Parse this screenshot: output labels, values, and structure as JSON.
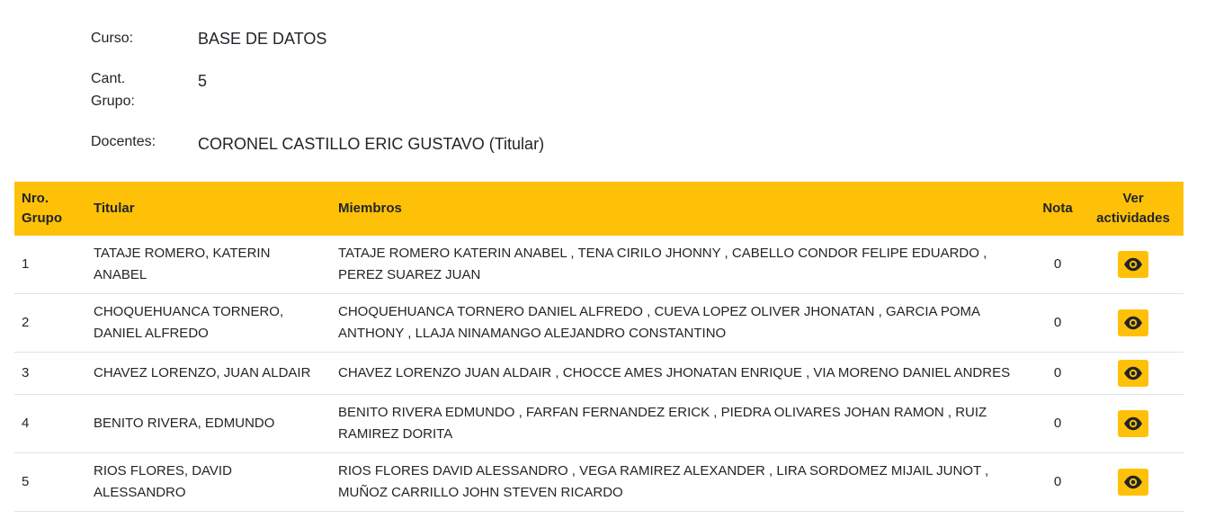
{
  "info": {
    "curso_label": "Curso:",
    "curso_value": "BASE DE DATOS",
    "cant_label": "Cant. Grupo:",
    "cant_value": "5",
    "docentes_label": "Docentes:",
    "docentes_value": "CORONEL CASTILLO ERIC GUSTAVO (Titular)"
  },
  "table": {
    "headers": {
      "nro": "Nro. Grupo",
      "titular": "Titular",
      "miembros": "Miembros",
      "nota": "Nota",
      "ver": "Ver actividades"
    },
    "rows": [
      {
        "nro": "1",
        "titular": "TATAJE ROMERO, KATERIN ANABEL",
        "miembros": "TATAJE ROMERO KATERIN ANABEL , TENA CIRILO JHONNY , CABELLO CONDOR FELIPE EDUARDO , PEREZ SUAREZ JUAN",
        "nota": "0",
        "action_icon": "eye-icon"
      },
      {
        "nro": "2",
        "titular": "CHOQUEHUANCA TORNERO, DANIEL ALFREDO",
        "miembros": "CHOQUEHUANCA TORNERO DANIEL ALFREDO , CUEVA LOPEZ OLIVER JHONATAN , GARCIA POMA ANTHONY , LLAJA NINAMANGO ALEJANDRO CONSTANTINO",
        "nota": "0",
        "action_icon": "eye-icon"
      },
      {
        "nro": "3",
        "titular": "CHAVEZ LORENZO, JUAN ALDAIR",
        "miembros": "CHAVEZ LORENZO JUAN ALDAIR , CHOCCE AMES JHONATAN ENRIQUE , VIA MORENO DANIEL ANDRES",
        "nota": "0",
        "action_icon": "eye-icon"
      },
      {
        "nro": "4",
        "titular": "BENITO RIVERA, EDMUNDO",
        "miembros": "BENITO RIVERA EDMUNDO , FARFAN FERNANDEZ ERICK , PIEDRA OLIVARES JOHAN RAMON , RUIZ RAMIREZ DORITA",
        "nota": "0",
        "action_icon": "eye-icon"
      },
      {
        "nro": "5",
        "titular": "RIOS FLORES, DAVID ALESSANDRO",
        "miembros": "RIOS FLORES DAVID ALESSANDRO , VEGA RAMIREZ ALEXANDER , LIRA SORDOMEZ MIJAIL JUNOT , MUÑOZ CARRILLO JOHN STEVEN RICARDO",
        "nota": "0",
        "action_icon": "eye-icon"
      }
    ]
  },
  "colors": {
    "header_bg": "#ffc107",
    "button_bg": "#ffc107",
    "text": "#212529",
    "row_border": "#dee2e6"
  }
}
